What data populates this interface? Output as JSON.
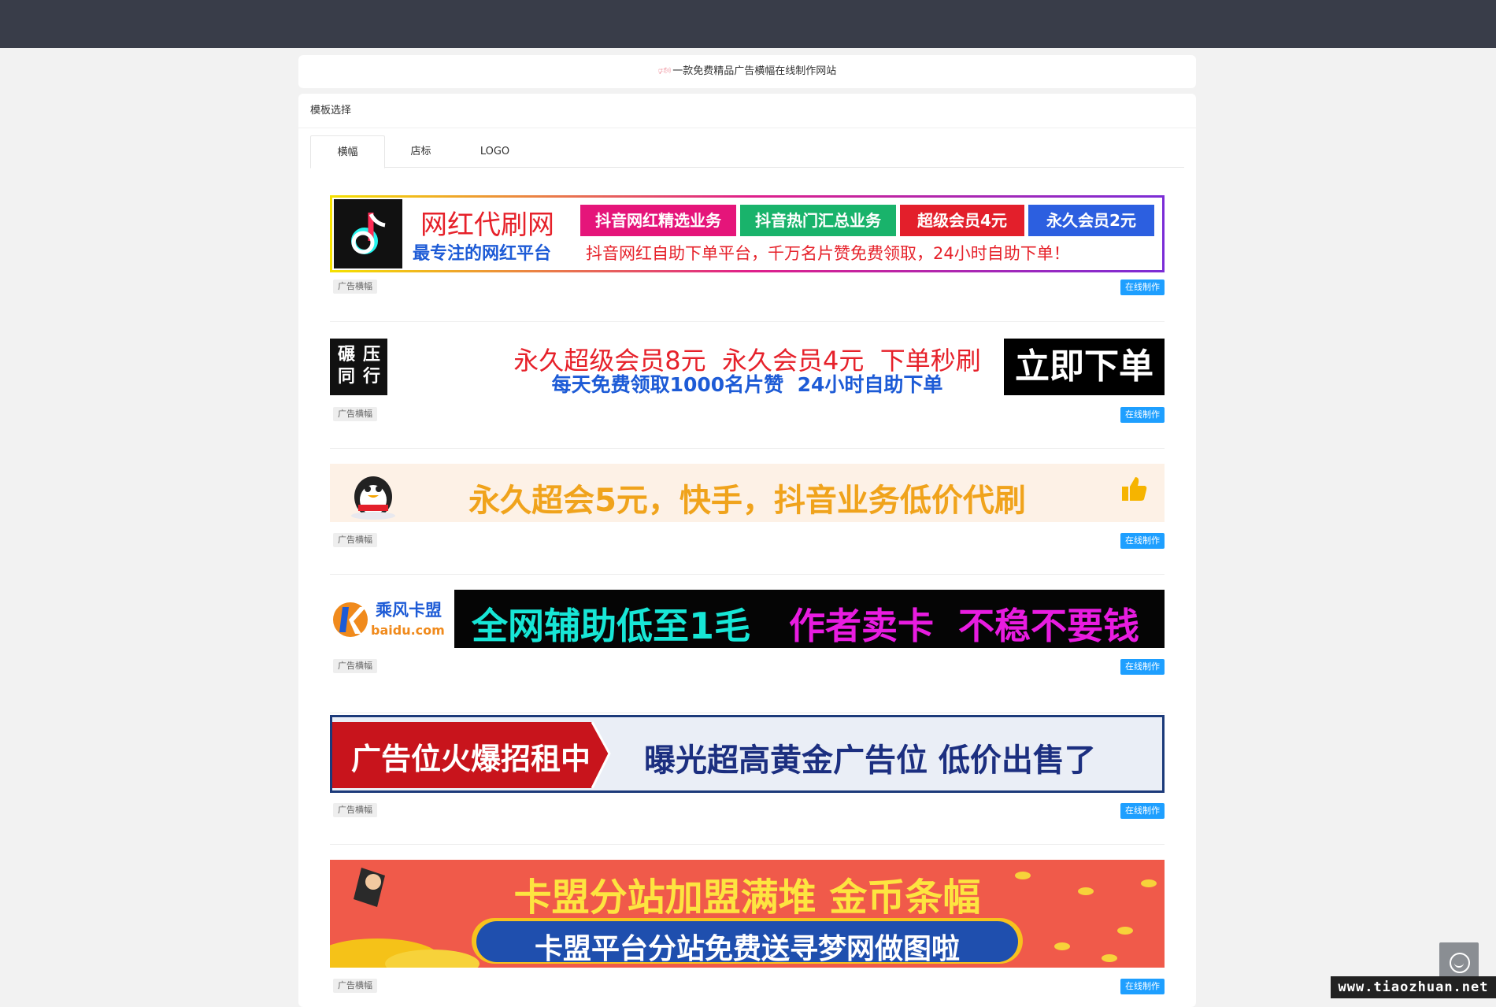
{
  "notice": {
    "text": "一款免费精品广告横幅在线制作网站"
  },
  "panel": {
    "title": "模板选择"
  },
  "tabs": [
    {
      "label": "横幅"
    },
    {
      "label": "店标"
    },
    {
      "label": "LOGO"
    }
  ],
  "items": [
    {
      "tag": "广告横幅",
      "action": "在线制作",
      "banner": {
        "title": "网红代刷网",
        "pills": [
          "抖音网红精选业务",
          "抖音热门汇总业务",
          "超级会员4元",
          "永久会员2元"
        ],
        "subtitle": "最专注的网红平台",
        "slogan": "抖音网红自助下单平台，千万名片赞免费领取，24小时自助下单！"
      }
    },
    {
      "tag": "广告横幅",
      "action": "在线制作",
      "banner": {
        "logo_text": [
          "碾",
          "压",
          "同",
          "行"
        ],
        "line1": "永久超级会员8元  永久会员4元  下单秒刷",
        "line2": "每天免费领取1000名片赞  24小时自助下单",
        "button": "立即下单"
      }
    },
    {
      "tag": "广告横幅",
      "action": "在线制作",
      "banner": {
        "text": "永久超会5元，快手，抖音业务低价代刷"
      }
    },
    {
      "tag": "广告横幅",
      "action": "在线制作",
      "banner": {
        "brand": "乘风卡盟",
        "domain": "baidu.com",
        "part1": "全网辅助低至1毛",
        "part2": "作者卖卡",
        "part3": "不稳不要钱"
      }
    },
    {
      "tag": "广告横幅",
      "action": "在线制作",
      "banner": {
        "left": "广告位火爆招租中",
        "right": "曝光超高黄金广告位 低价出售了"
      }
    },
    {
      "tag": "广告横幅",
      "action": "在线制作",
      "banner": {
        "line1": "卡盟分站加盟满堆 金币条幅",
        "line2": "卡盟平台分站免费送寻梦网做图啦"
      }
    }
  ],
  "watermark": "www.tiaozhuan.net",
  "colors": {
    "topbar": "#393d49",
    "accent": "#1e9fff",
    "background": "#f2f2f2"
  }
}
